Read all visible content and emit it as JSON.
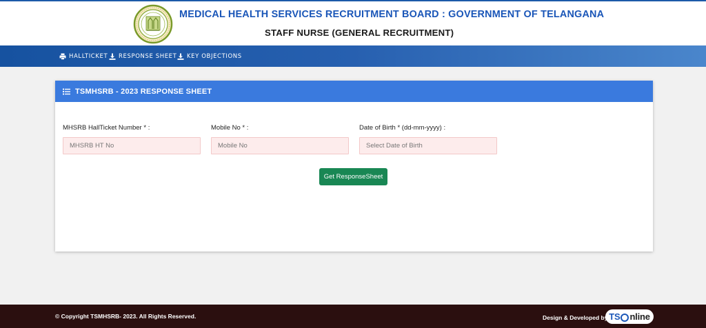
{
  "header": {
    "title": "MEDICAL HEALTH SERVICES RECRUITMENT BOARD : GOVERNMENT OF TELANGANA",
    "subtitle": "STAFF NURSE (GENERAL RECRUITMENT)",
    "emblem_icon": "telangana-emblem-icon"
  },
  "nav": {
    "items": [
      {
        "label": "HALLTICKET",
        "icon": "printer-icon"
      },
      {
        "label": "RESPONSE SHEET",
        "icon": "download-icon"
      },
      {
        "label": "KEY OBJECTIONS",
        "icon": "download-icon"
      }
    ]
  },
  "card": {
    "title": "TSMHSRB - 2023 RESPONSE SHEET",
    "icon": "list-icon"
  },
  "form": {
    "hallticket": {
      "label": "MHSRB HallTicket Number * :",
      "placeholder": "MHSRB HT No",
      "value": ""
    },
    "mobile": {
      "label": "Mobile No * :",
      "placeholder": "Mobile No",
      "value": ""
    },
    "dob": {
      "label": "Date of Birth * (dd-mm-yyyy) :",
      "placeholder": "Select Date of Birth",
      "value": ""
    },
    "submit_label": "Get ResponseSheet"
  },
  "footer": {
    "copyright": "© Copyright TSMHSRB- 2023. All Rights Reserved.",
    "developed_by": "Design & Developed by",
    "brand_prefix": "TS",
    "brand_suffix": "nline"
  },
  "colors": {
    "header_title": "#1a56b8",
    "navbar": "#1652a0",
    "card_header": "#3a7ade",
    "input_bg": "#fdecec",
    "submit": "#198754",
    "footer": "#2b0f0f"
  }
}
